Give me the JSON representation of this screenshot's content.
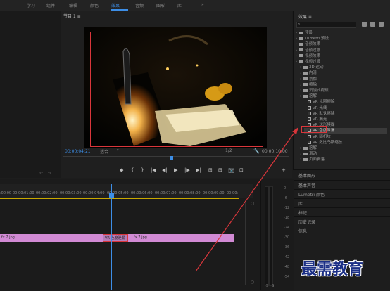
{
  "menu": {
    "tabs": [
      "学习",
      "组件",
      "编辑",
      "颜色",
      "效果",
      "音频",
      "图形",
      "库"
    ],
    "active_index": 4,
    "more": "»"
  },
  "program": {
    "title": "节目 1 ≡",
    "timecode_current": "00:00:04:21",
    "fit": "适合",
    "resolution": "1/2",
    "timecode_total": "00:00:10:00",
    "controls": [
      "◆",
      "{",
      "}",
      "|◀",
      "◀|",
      "▶",
      "|▶",
      "▶|",
      "⊞",
      "⊟",
      "📷",
      "⊡",
      "+"
    ]
  },
  "effects": {
    "title": "效果 ≡",
    "search_placeholder": "",
    "items": [
      {
        "label": "预设",
        "type": "folder",
        "depth": 0
      },
      {
        "label": "Lumetri 预设",
        "type": "folder",
        "depth": 0
      },
      {
        "label": "音频效果",
        "type": "folder",
        "depth": 0
      },
      {
        "label": "音频过渡",
        "type": "folder",
        "depth": 0
      },
      {
        "label": "视频效果",
        "type": "folder",
        "depth": 0
      },
      {
        "label": "视频过渡",
        "type": "folder",
        "depth": 0
      },
      {
        "label": "3D 运动",
        "type": "folder",
        "depth": 1
      },
      {
        "label": "内滑",
        "type": "folder",
        "depth": 1
      },
      {
        "label": "划像",
        "type": "folder",
        "depth": 1
      },
      {
        "label": "擦除",
        "type": "folder",
        "depth": 1
      },
      {
        "label": "沉浸式视频",
        "type": "folder",
        "depth": 1
      },
      {
        "label": "溶解",
        "type": "folder",
        "depth": 1
      },
      {
        "label": "VR 光圈擦除",
        "type": "fx",
        "depth": 2
      },
      {
        "label": "VR 光线",
        "type": "fx",
        "depth": 2
      },
      {
        "label": "VR 默认擦除",
        "type": "fx",
        "depth": 2
      },
      {
        "label": "VR 漏光",
        "type": "fx",
        "depth": 2
      },
      {
        "label": "VR 球形模糊",
        "type": "fx",
        "depth": 2
      },
      {
        "label": "VR 色度泄漏",
        "type": "fx",
        "depth": 2,
        "selected": true
      },
      {
        "label": "VR 随机块",
        "type": "fx",
        "depth": 2
      },
      {
        "label": "VR 数比乌斯缩放",
        "type": "fx",
        "depth": 2
      },
      {
        "label": "溶解",
        "type": "folder",
        "depth": 1
      },
      {
        "label": "滑动",
        "type": "folder",
        "depth": 1
      },
      {
        "label": "页面剥落",
        "type": "folder",
        "depth": 1
      }
    ]
  },
  "side_panels": [
    "基本图形",
    "基本声音",
    "Lumetri 颜色",
    "库",
    "标记",
    "历史记录",
    "信息"
  ],
  "timeline": {
    "ticks": [
      ":00:00",
      "00:00:01:00",
      "00:00:02:00",
      "00:00:03:00",
      "00:00:04:00",
      "00:00:05:00",
      "00:00:06:00",
      "00:00:07:00",
      "00:00:08:00",
      "00:00:09:00",
      "00:00:"
    ],
    "clip_left_label": "fx 7.jpg",
    "clip_right_label": "fx 7.jpg",
    "transition_label": "VR 色度泄漏"
  },
  "meter": {
    "db_labels": [
      "0",
      "-6",
      "-12",
      "-18",
      "-24",
      "-30",
      "-36",
      "-42",
      "-48",
      "-54"
    ],
    "bottom_labels": [
      "S",
      "S"
    ]
  },
  "watermark": "最需教育"
}
